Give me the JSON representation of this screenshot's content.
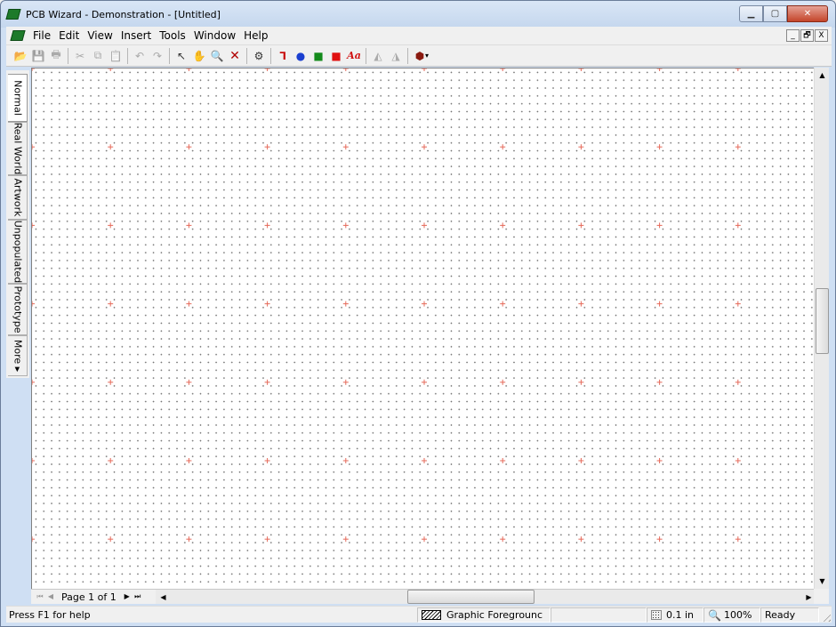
{
  "window": {
    "title": "PCB Wizard - Demonstration - [Untitled]",
    "controls": [
      "minimize",
      "maximize",
      "close"
    ]
  },
  "menubar": {
    "items": [
      "File",
      "Edit",
      "View",
      "Insert",
      "Tools",
      "Window",
      "Help"
    ],
    "mdi_controls": [
      "_",
      "🗗",
      "X"
    ]
  },
  "toolbar": {
    "buttons": [
      {
        "name": "open-icon",
        "glyph": "📂"
      },
      {
        "name": "save-icon",
        "glyph": "💾"
      },
      {
        "name": "print-icon",
        "glyph": "🖶"
      },
      {
        "name": "cut-icon",
        "glyph": "✂"
      },
      {
        "name": "copy-icon",
        "glyph": "⧉"
      },
      {
        "name": "paste-icon",
        "glyph": "📋"
      },
      {
        "name": "undo-icon",
        "glyph": "↶"
      },
      {
        "name": "redo-icon",
        "glyph": "↷"
      },
      {
        "name": "select-icon",
        "glyph": "↖"
      },
      {
        "name": "pan-icon",
        "glyph": "✋"
      },
      {
        "name": "zoom-icon",
        "glyph": "🔍"
      },
      {
        "name": "delete-icon",
        "glyph": "✕"
      },
      {
        "name": "component-icon",
        "glyph": "⚙"
      },
      {
        "name": "track-icon",
        "glyph": "⅂"
      },
      {
        "name": "pad-icon",
        "glyph": "●"
      },
      {
        "name": "square-pad-icon",
        "glyph": "■"
      },
      {
        "name": "copper-area-icon",
        "glyph": "■"
      },
      {
        "name": "text-icon",
        "glyph": "Aa"
      },
      {
        "name": "flip-horizontal-icon",
        "glyph": "◭"
      },
      {
        "name": "flip-vertical-icon",
        "glyph": "◮"
      },
      {
        "name": "gallery-icon",
        "glyph": "⬢"
      }
    ]
  },
  "vtabs": {
    "items": [
      "Normal",
      "Real World",
      "Artwork",
      "Unpopulated",
      "Prototype",
      "More ▸"
    ]
  },
  "pagenav": {
    "label": "Page 1 of 1"
  },
  "statusbar": {
    "help_text": "Press F1 for help",
    "layer": "Graphic Foregrounc",
    "grid": "0.1 in",
    "zoom": "100%",
    "state": "Ready"
  },
  "colors": {
    "canvas": "#ffffff",
    "grid_dot": "#6f6f6f",
    "grid_cross": "#e56a5a",
    "chrome": "#f0f0f0"
  }
}
